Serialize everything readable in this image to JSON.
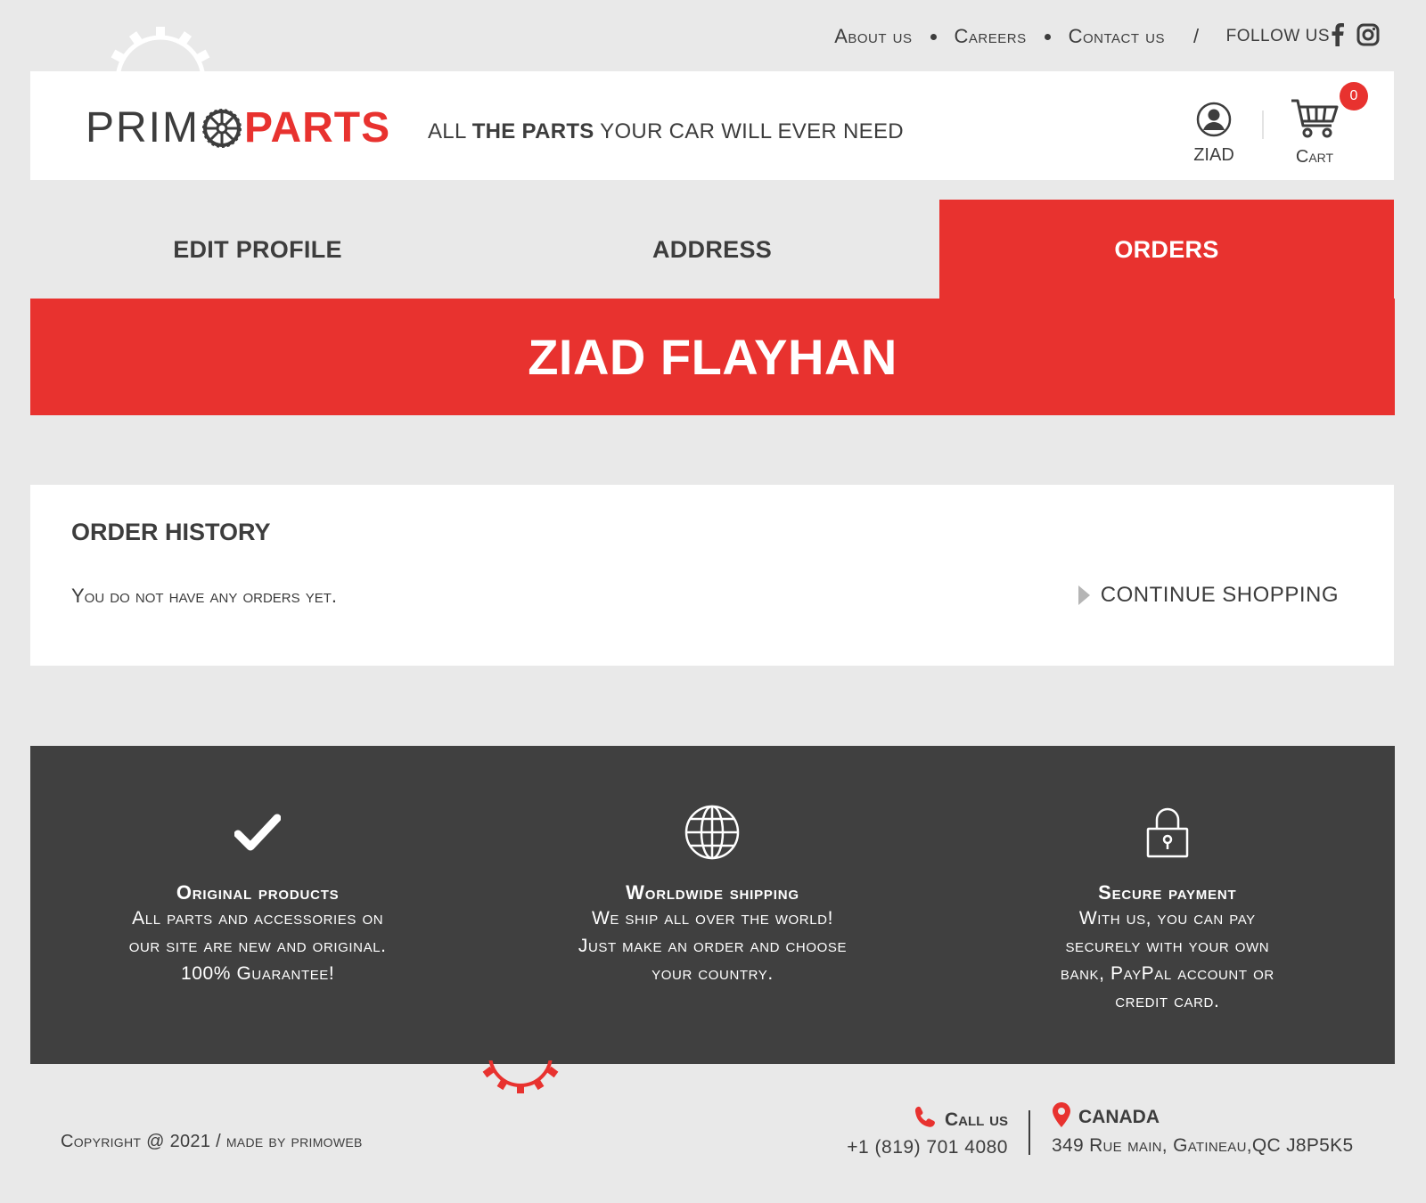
{
  "colors": {
    "accent": "#e8322f",
    "dark": "#404040",
    "background": "#e9e9e9"
  },
  "topnav": {
    "about": "About us",
    "careers": "Careers",
    "contact": "Contact us",
    "separator": "/",
    "follow": "follow us",
    "social_icons": [
      "facebook-icon",
      "instagram-icon"
    ]
  },
  "header": {
    "logo_left": "PRIM",
    "logo_right": "PARTS",
    "tagline_1": "ALL ",
    "tagline_2": "THE PARTS",
    "tagline_3": " YOUR CAR  WILL EVER NEED",
    "account_label": "ZIAD",
    "cart_label": "Cart",
    "cart_count": "0"
  },
  "tabs": [
    {
      "label": "EDIT PROFILE",
      "active": false
    },
    {
      "label": "ADDRESS",
      "active": false
    },
    {
      "label": "ORDERS",
      "active": true
    }
  ],
  "banner": {
    "name": "ZIAD FLAYHAN"
  },
  "orders": {
    "title": "ORDER HISTORY",
    "empty_message": "You do not have any orders yet.",
    "continue_label": "CONTINUE  SHOPPING"
  },
  "features": [
    {
      "icon": "check-icon",
      "title": "Original products",
      "lines": [
        "All parts and accessories on",
        "our site are new and original.",
        "100% Guarantee!"
      ]
    },
    {
      "icon": "globe-icon",
      "title": "Worldwide shipping",
      "lines": [
        "We ship all over the world!",
        "Just make an order and choose",
        "your country."
      ]
    },
    {
      "icon": "lock-icon",
      "title": "Secure payment",
      "lines": [
        "With us, you can pay",
        "securely with your own",
        "bank, PayPal account or",
        "credit card."
      ]
    }
  ],
  "footer": {
    "copyright": "Copyright @ 2021 /  made by primoweb",
    "call_label": "Call us",
    "phone": "+1 (819) 701 4080",
    "location_label": "CANADA",
    "address": "349 Rue main, Gatineau,QC J8P5K5"
  }
}
